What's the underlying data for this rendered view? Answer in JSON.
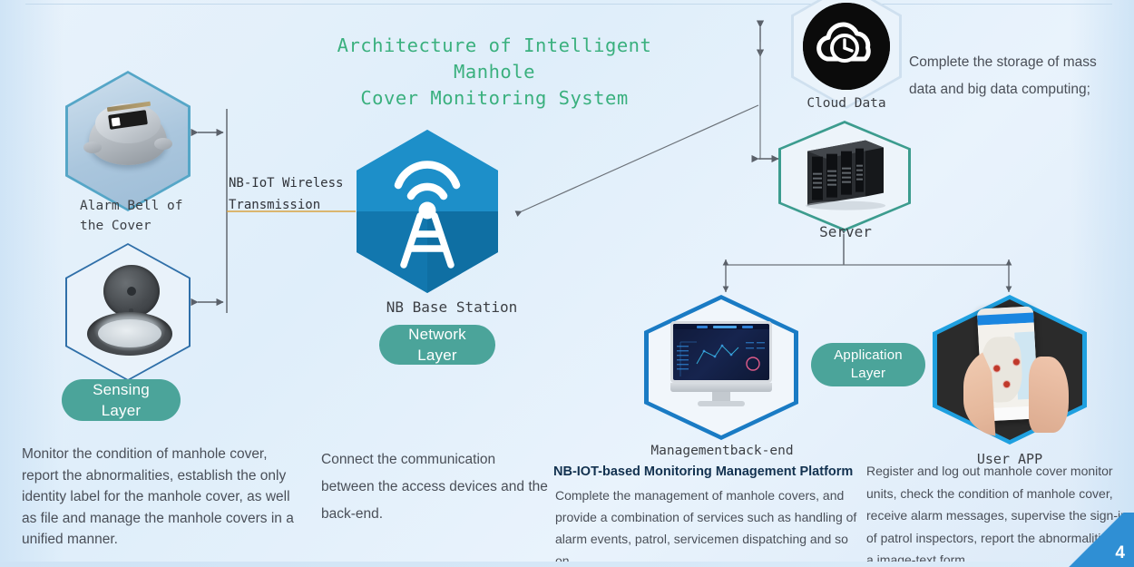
{
  "slide": {
    "title_line1": "Architecture of Intelligent Manhole",
    "title_line2": "Cover Monitoring System",
    "page_number": "4",
    "accent_green": "#3ab07e",
    "accent_teal": "#4ba49a",
    "accent_blue": "#1785bd"
  },
  "sensing": {
    "alarm_bell_label_line1": "Alarm Bell of",
    "alarm_bell_label_line2": "the Cover",
    "layer_pill_line1": "Sensing",
    "layer_pill_line2": "Layer",
    "description": "Monitor the condition of manhole cover, report the abnormalities, establish the only identity label for the manhole cover, as well as file and manage the manhole covers in a unified manner."
  },
  "network": {
    "transmission_label_line1": "NB-IoT Wireless",
    "transmission_label_line2": "Transmission",
    "base_station_label": "NB Base Station",
    "layer_pill_line1": "Network",
    "layer_pill_line2": "Layer",
    "description": "Connect the communication between the access devices and the back-end."
  },
  "platform": {
    "cloud_label": "Cloud Data",
    "server_label": "Server",
    "cloud_description": "Complete the storage of mass data and big data computing;"
  },
  "application": {
    "backend_label": "Managementback-end",
    "userapp_label": "User APP",
    "layer_pill_line1": "Application",
    "layer_pill_line2": "Layer",
    "platform_heading": "NB-IOT-based Monitoring Management Platform",
    "platform_description": "Complete the management of manhole covers, and provide a combination of services such as handling of alarm events, patrol, servicemen dispatching and so on.",
    "userapp_description": "Register and log out manhole cover monitor units, check the condition of manhole cover, receive alarm messages, supervise the sign-in of patrol inspectors, report the abnormalities in a image-text form."
  }
}
